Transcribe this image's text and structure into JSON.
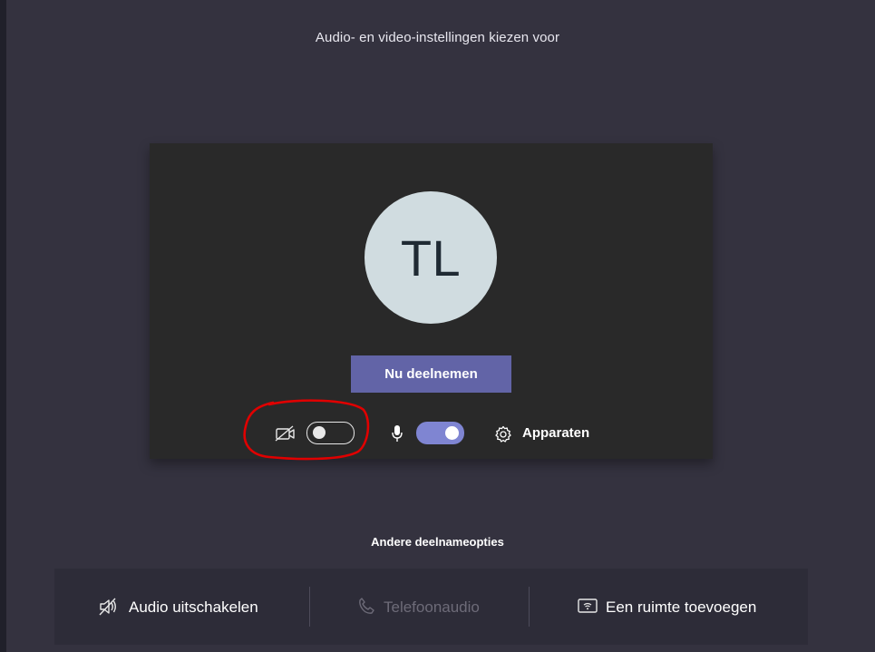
{
  "header": {
    "title": "Audio- en video-instellingen kiezen voor"
  },
  "preview": {
    "avatar_initials": "TL",
    "join_button_label": "Nu deelnemen",
    "camera_toggle": {
      "state": "off",
      "icon": "video-off-icon"
    },
    "mic_toggle": {
      "state": "on",
      "icon": "microphone-icon"
    },
    "devices": {
      "label": "Apparaten",
      "icon": "gear-icon"
    }
  },
  "other_options": {
    "title": "Andere deelnameopties",
    "items": [
      {
        "label": "Audio uitschakelen",
        "icon": "speaker-off-icon",
        "enabled": true
      },
      {
        "label": "Telefoonaudio",
        "icon": "phone-icon",
        "enabled": false
      },
      {
        "label": "Een ruimte toevoegen",
        "icon": "room-cast-icon",
        "enabled": true
      }
    ]
  },
  "colors": {
    "background": "#34323f",
    "card": "#292929",
    "avatar": "#d0dce0",
    "accent": "#6264a7",
    "toggle_on": "#7f85d2",
    "annotation": "#e00000",
    "disabled_text": "#6d6b78"
  }
}
